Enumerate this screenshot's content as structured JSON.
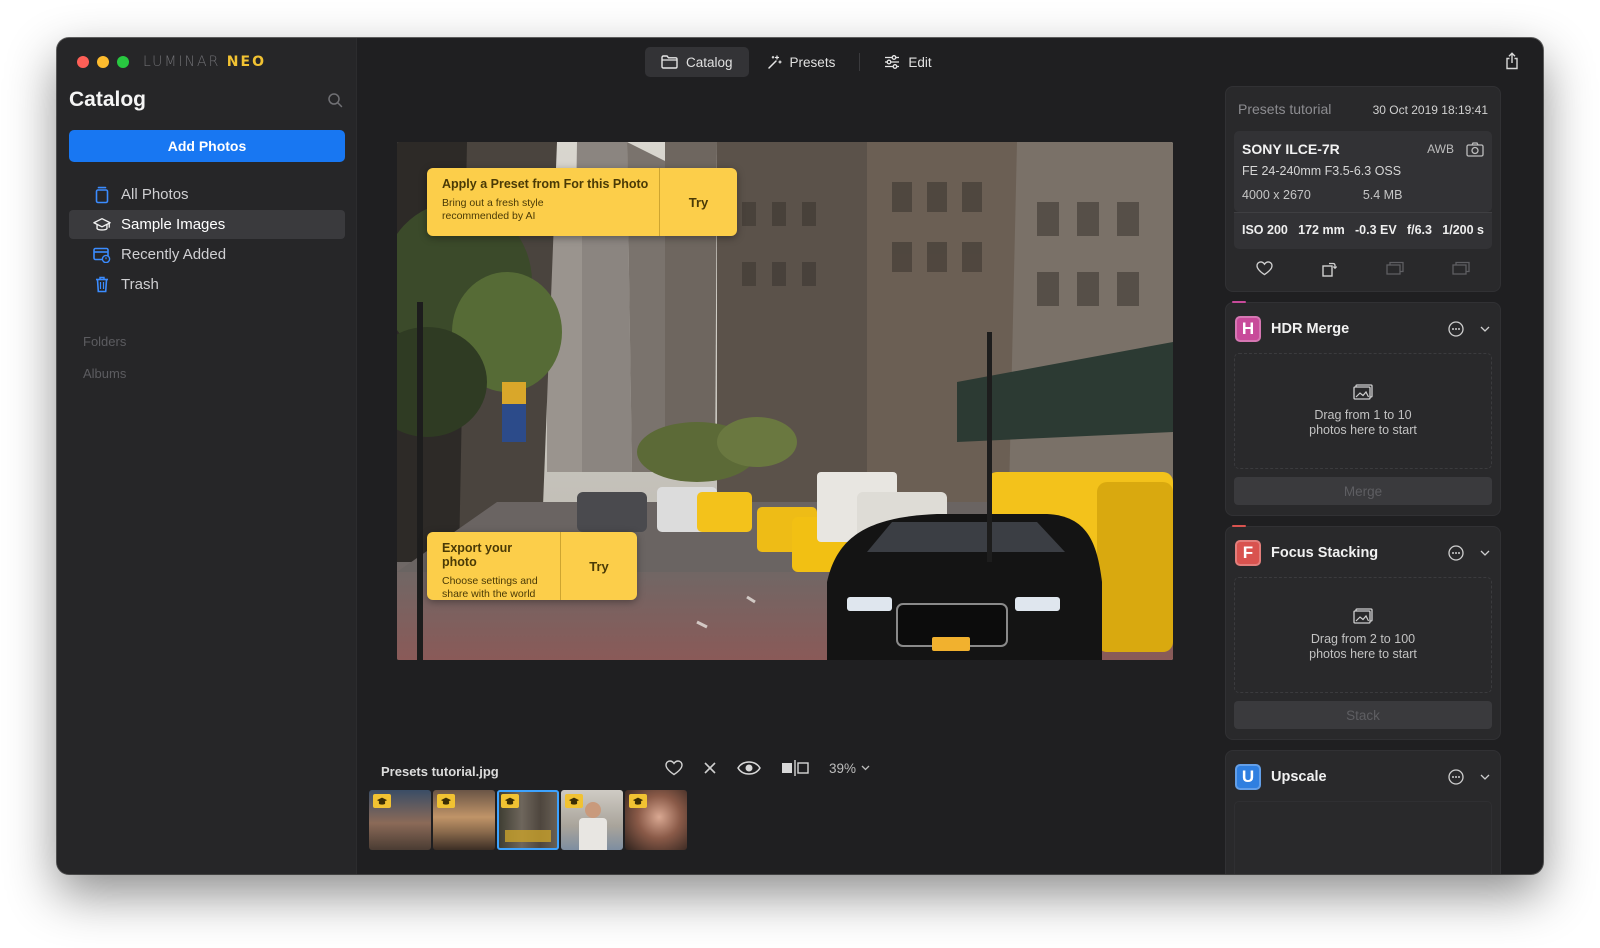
{
  "window": {
    "brand_light": "LUMINAR",
    "brand_bold": "NEO"
  },
  "sidebar": {
    "title": "Catalog",
    "add_photos": "Add Photos",
    "items": [
      {
        "label": "All Photos",
        "icon": "all-photos-icon"
      },
      {
        "label": "Sample Images",
        "icon": "graduation-cap-icon",
        "active": true
      },
      {
        "label": "Recently Added",
        "icon": "recently-added-icon"
      },
      {
        "label": "Trash",
        "icon": "trash-icon"
      }
    ],
    "folders_label": "Folders",
    "albums_label": "Albums"
  },
  "top_tabs": [
    {
      "label": "Catalog",
      "icon": "folder-icon",
      "active": true
    },
    {
      "label": "Presets",
      "icon": "presets-icon"
    },
    {
      "label": "Edit",
      "icon": "sliders-icon"
    }
  ],
  "tips": [
    {
      "title": "Apply a Preset from For this Photo",
      "line1": "Bring out a fresh style",
      "line2": "recommended by AI",
      "action": "Try"
    },
    {
      "title": "Export your photo",
      "line1": "Choose settings and",
      "line2": "share with the world",
      "action": "Try"
    }
  ],
  "filmstrip": {
    "filename": "Presets tutorial.jpg",
    "zoom": "39%",
    "thumbnails": [
      "thumb-1",
      "thumb-2",
      "thumb-3",
      "thumb-4",
      "thumb-5"
    ],
    "selected_index": 2
  },
  "info": {
    "name": "Presets tutorial",
    "date": "30 Oct 2019 18:19:41",
    "camera": "SONY ILCE-7R",
    "white_balance": "AWB",
    "lens": "FE 24-240mm F3.5-6.3 OSS",
    "dimensions": "4000 x 2670",
    "size": "5.4 MB",
    "exif": [
      "ISO 200",
      "172 mm",
      "-0.3 EV",
      "f/6.3",
      "1/200 s"
    ]
  },
  "tools": [
    {
      "letter": "H",
      "name": "HDR Merge",
      "drop_line1": "Drag from 1 to 10",
      "drop_line2": "photos here to start",
      "button": "Merge",
      "color": "#c84a9a"
    },
    {
      "letter": "F",
      "name": "Focus Stacking",
      "drop_line1": "Drag from 2 to 100",
      "drop_line2": "photos here to start",
      "button": "Stack",
      "color": "#d9534f"
    },
    {
      "letter": "U",
      "name": "Upscale",
      "color": "#2f7fe0"
    }
  ],
  "colors": {
    "accent_blue": "#1877f2",
    "tip_yellow": "#fcce4a",
    "selection_blue": "#3da3ff"
  }
}
